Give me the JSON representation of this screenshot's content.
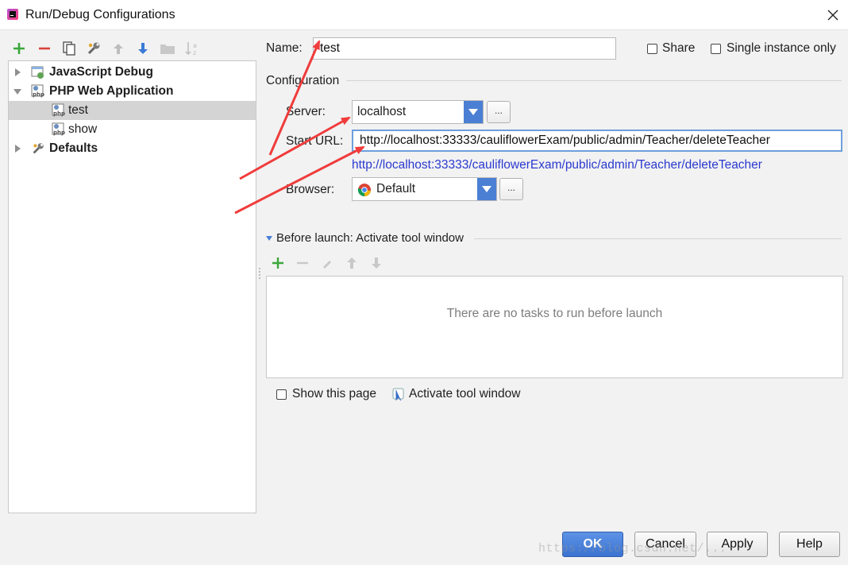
{
  "window": {
    "title": "Run/Debug Configurations",
    "app_icon": "phpstorm-icon",
    "close_icon": "close-icon"
  },
  "toolbar": {
    "buttons": [
      "add-icon",
      "remove-icon",
      "copy-icon",
      "wrench-icon",
      "move-up-icon",
      "move-down-icon",
      "folder-icon",
      "sort-icon"
    ]
  },
  "tree": {
    "items": [
      {
        "label": "JavaScript Debug",
        "level": 0,
        "expanded": false,
        "bold": true
      },
      {
        "label": "PHP Web Application",
        "level": 0,
        "expanded": true,
        "bold": true
      },
      {
        "label": "test",
        "level": 1,
        "selected": true
      },
      {
        "label": "show",
        "level": 1
      },
      {
        "label": "Defaults",
        "level": 0,
        "expanded": false,
        "bold": true
      }
    ]
  },
  "form": {
    "name_label": "Name:",
    "name_value": "test",
    "share_label": "Share",
    "single_instance_label": "Single instance only",
    "configuration_heading": "Configuration",
    "server_label": "Server:",
    "server_value": "localhost",
    "dots": "...",
    "start_url_label": "Start URL:",
    "start_url_value": "http://localhost:33333/cauliflowerExam/public/admin/Teacher/deleteTeacher",
    "resolved_url": "http://localhost:33333/cauliflowerExam/public/admin/Teacher/deleteTeacher",
    "browser_label": "Browser:",
    "browser_value": "Default"
  },
  "before_launch": {
    "heading": "Before launch: Activate tool window",
    "empty_text": "There are no tasks to run before launch",
    "show_page_label": "Show this page",
    "activate_tool_label": "Activate tool window",
    "show_page_checked": false,
    "activate_tool_checked": true
  },
  "buttons": {
    "ok": "OK",
    "cancel": "Cancel",
    "apply": "Apply",
    "help": "Help"
  },
  "watermark": "https://blog.csdn.net/...",
  "colors": {
    "accent": "#4a7fd4",
    "link": "#2a39cf",
    "annotation_arrow": "#f03c3c",
    "selection": "#d4d4d4"
  }
}
